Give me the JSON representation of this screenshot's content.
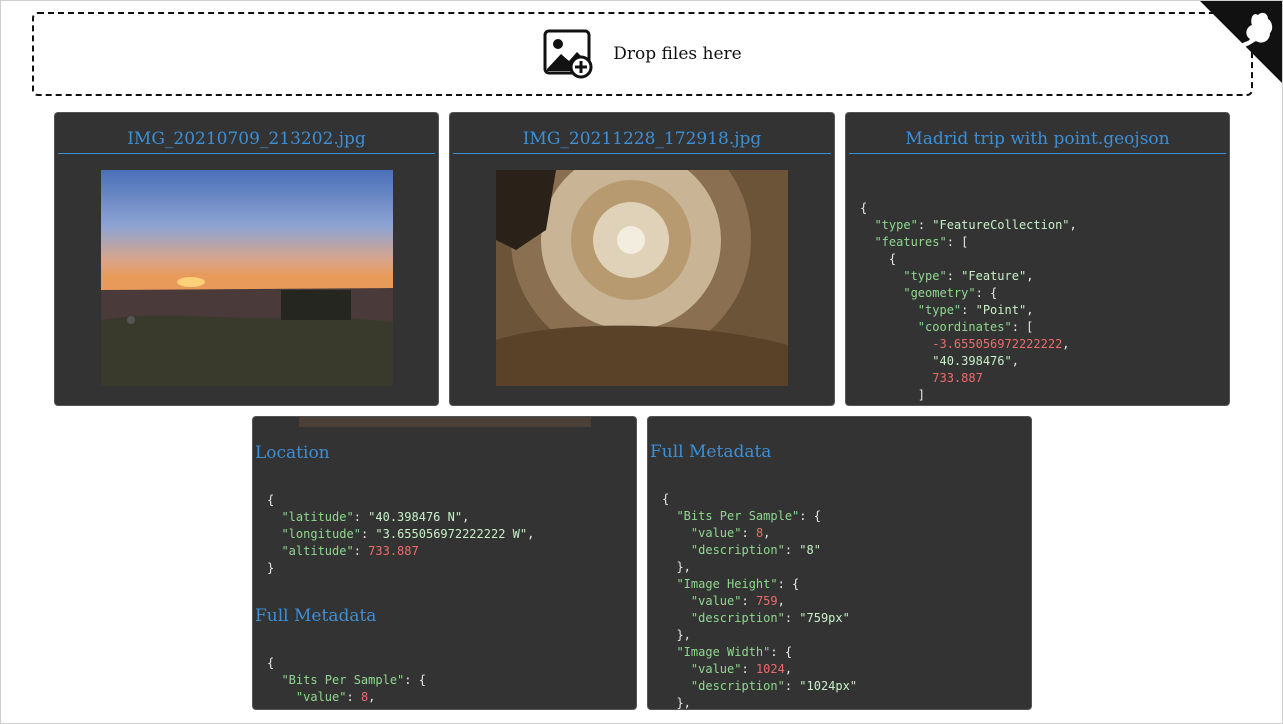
{
  "dropzone": {
    "label": "Drop files here",
    "icon": "image-add-icon"
  },
  "corner": {
    "icon": "github-octocat-icon"
  },
  "cards": [
    {
      "title": "IMG_20210709_213202.jpg",
      "image": "sunset-over-park-photo"
    },
    {
      "title": "IMG_20211228_172918.jpg",
      "image": "church-dome-interior-photo"
    },
    {
      "title": "Madrid trip with point.geojson"
    }
  ],
  "location_section": {
    "title": "Location",
    "latitude_key": "\"latitude\"",
    "latitude_val": "\"40.398476 N\"",
    "longitude_key": "\"longitude\"",
    "longitude_val": "\"3.655056972222222 W\"",
    "altitude_key": "\"altitude\"",
    "altitude_val": "733.887"
  },
  "geojson": {
    "type_key": "\"type\"",
    "type_val": "\"FeatureCollection\"",
    "features_key": "\"features\"",
    "ftype_key": "\"type\"",
    "ftype_val": "\"Feature\"",
    "geometry_key": "\"geometry\"",
    "gtype_key": "\"type\"",
    "gtype_val": "\"Point\"",
    "coords_key": "\"coordinates\"",
    "coord_1": "-3.655056972222222",
    "coord_2": "\"40.398476\"",
    "coord_3": "733.887"
  },
  "metadata_left": {
    "title": "Full Metadata",
    "bps_key": "\"Bits Per Sample\"",
    "value_key": "\"value\"",
    "bps_value": "8"
  },
  "metadata_right": {
    "title": "Full Metadata",
    "bps_key": "\"Bits Per Sample\"",
    "value_key": "\"value\"",
    "desc_key": "\"description\"",
    "bps_value": "8",
    "bps_desc": "\"8\"",
    "height_key": "\"Image Height\"",
    "height_value": "759",
    "height_desc": "\"759px\"",
    "width_key": "\"Image Width\"",
    "width_value": "1024",
    "width_desc": "\"1024px\""
  }
}
